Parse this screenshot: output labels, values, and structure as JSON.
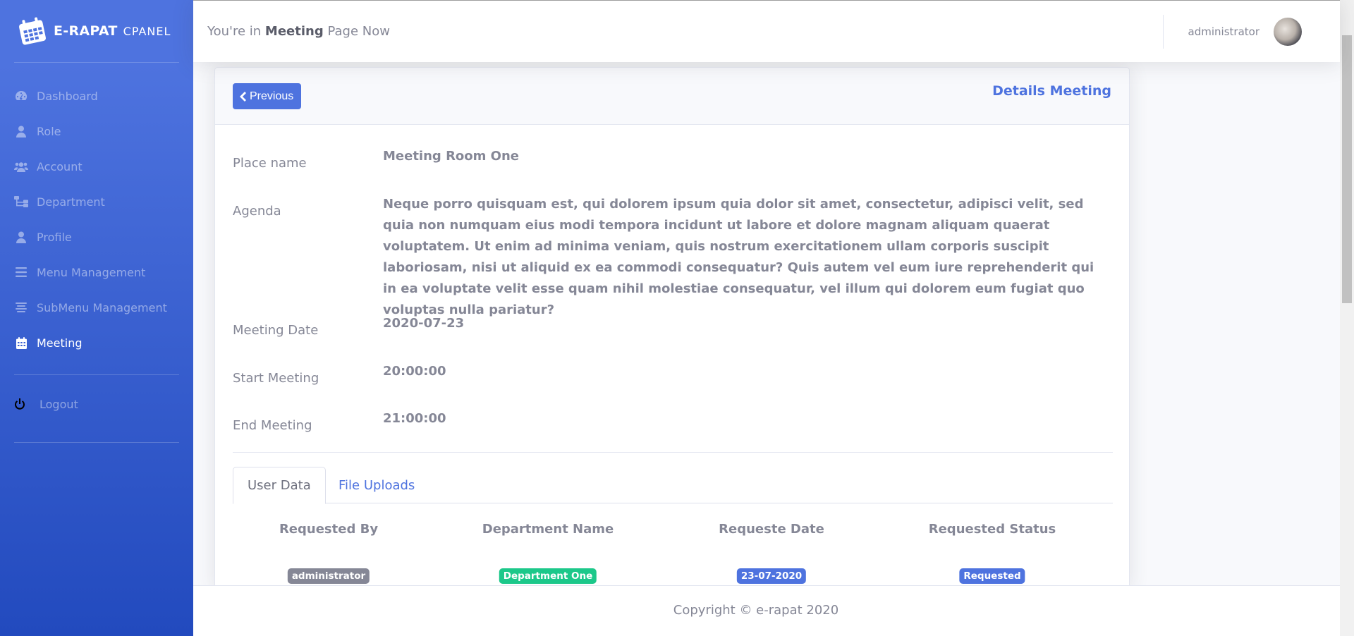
{
  "brand": {
    "name": "E-RAPAT",
    "sub": "CPANEL"
  },
  "sidebar": {
    "items": [
      {
        "label": "Dashboard",
        "icon": "tachometer-icon",
        "active": false
      },
      {
        "label": "Role",
        "icon": "user-icon",
        "active": false
      },
      {
        "label": "Account",
        "icon": "users-icon",
        "active": false
      },
      {
        "label": "Department",
        "icon": "sitemap-icon",
        "active": false
      },
      {
        "label": "Profile",
        "icon": "user-icon",
        "active": false
      },
      {
        "label": "Menu Management",
        "icon": "bars-icon",
        "active": false
      },
      {
        "label": "SubMenu Management",
        "icon": "align-center-icon",
        "active": false
      },
      {
        "label": "Meeting",
        "icon": "calendar-icon",
        "active": true
      }
    ],
    "logout": "Logout"
  },
  "topbar": {
    "prefix": "You're in",
    "page": "Meeting",
    "suffix": "Page Now",
    "user": "administrator"
  },
  "card": {
    "back_label": "Previous",
    "title": "Details Meeting"
  },
  "details": {
    "place_label": "Place name",
    "place_value": "Meeting Room One",
    "agenda_label": "Agenda",
    "agenda_value": "Neque porro quisquam est, qui dolorem ipsum quia dolor sit amet, consectetur, adipisci velit, sed quia non numquam eius modi tempora incidunt ut labore et dolore magnam aliquam quaerat voluptatem. Ut enim ad minima veniam, quis nostrum exercitationem ullam corporis suscipit laboriosam, nisi ut aliquid ex ea commodi consequatur? Quis autem vel eum iure reprehenderit qui in ea voluptate velit esse quam nihil molestiae consequatur, vel illum qui dolorem eum fugiat quo voluptas nulla pariatur?",
    "date_label": "Meeting Date",
    "date_value": "2020-07-23",
    "start_label": "Start Meeting",
    "start_value": "20:00:00",
    "end_label": "End Meeting",
    "end_value": "21:00:00"
  },
  "tabs": [
    {
      "label": "User Data",
      "active": true
    },
    {
      "label": "File Uploads",
      "active": false
    }
  ],
  "table": {
    "headers": [
      "Requested By",
      "Department Name",
      "Requeste Date",
      "Requested Status"
    ],
    "rows": [
      {
        "requested_by": "administrator",
        "department": "Department One",
        "date": "23-07-2020",
        "status": "Requested"
      }
    ]
  },
  "colors": {
    "primary": "#4e73df",
    "secondary_badge": "#858796",
    "success_badge": "#1cc88a"
  },
  "footer": {
    "copyright": "Copyright © e-rapat 2020"
  }
}
